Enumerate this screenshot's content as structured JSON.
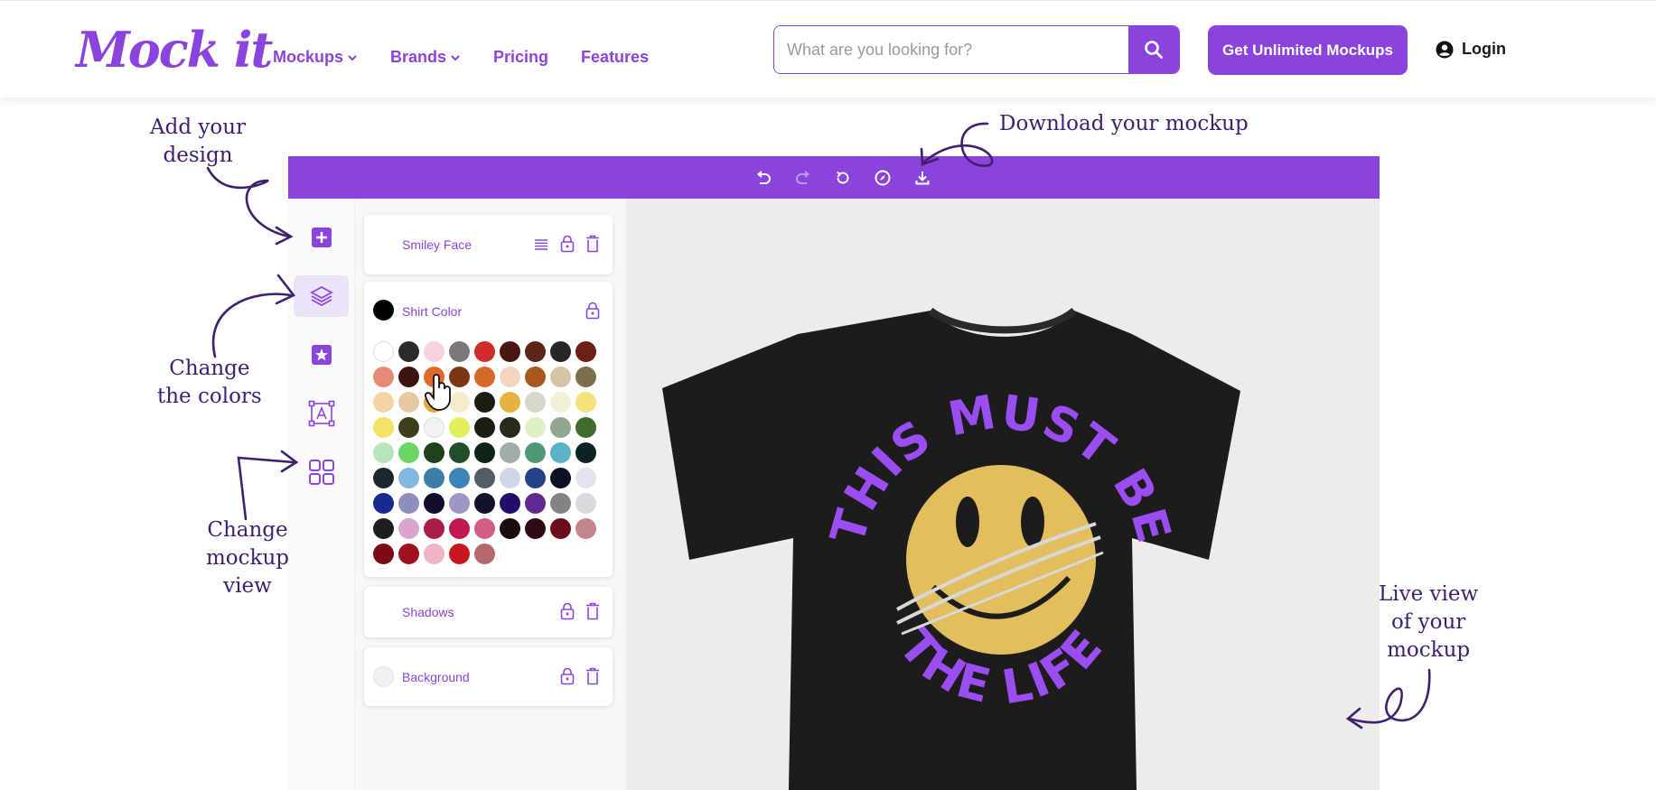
{
  "header": {
    "logo": "Mock it",
    "nav": [
      {
        "label": "Mockups",
        "dropdown": true
      },
      {
        "label": "Brands",
        "dropdown": true
      },
      {
        "label": "Pricing",
        "dropdown": false
      },
      {
        "label": "Features",
        "dropdown": false
      }
    ],
    "search_placeholder": "What are you looking for?",
    "cta_label": "Get Unlimited Mockups",
    "login_label": "Login"
  },
  "annotations": {
    "add_design": "Add your\ndesign",
    "download": "Download your mockup",
    "change_colors": "Change\nthe colors",
    "change_view": "Change\nmockup\nview",
    "live_view": "Live view\nof your\nmockup"
  },
  "toolbar": {
    "icons": [
      "undo-icon",
      "redo-icon",
      "reset-icon",
      "compass-icon",
      "download-icon"
    ]
  },
  "sidebar": {
    "tools": [
      "add-icon",
      "layers-icon",
      "star-icon",
      "text-icon",
      "grid-icon"
    ],
    "active": "layers-icon"
  },
  "layers": {
    "design_name": "Smiley Face",
    "shirt_color_label": "Shirt Color",
    "shirt_color": "#000000",
    "shadows_label": "Shadows",
    "background_label": "Background"
  },
  "palette": [
    [
      "#ffffff",
      "#2b2b2b",
      "#f6d3dc",
      "#7c7878",
      "#d32b2b",
      "#4a1410",
      "#5d2418",
      "#262626",
      "#6b1f16"
    ],
    [
      "#e58b73",
      "#3e1410",
      "#e06a2a",
      "#7b3512",
      "#d56a28",
      "#f3d5c0",
      "#a8581d",
      "#d4c3a4",
      "#7d6e4e"
    ],
    [
      "#f2d4a5",
      "#e6c9a2",
      "#e5aa3c",
      "#f3edcd",
      "#1d1c14",
      "#e7b13d",
      "#d5d6cd",
      "#f2f0d8",
      "#f4e27c"
    ],
    [
      "#f4e266",
      "#3d3f1a",
      "#f1f3ee",
      "#dff05c",
      "#1b1e14",
      "#272b1c",
      "#dfefc6",
      "#8fa68f",
      "#3f6b2c"
    ],
    [
      "#b8e3bb",
      "#69d564",
      "#1e4219",
      "#234c2a",
      "#0f2419",
      "#a2ada9",
      "#4f9775",
      "#59b2c7",
      "#0d2222"
    ],
    [
      "#1c2631",
      "#82b8df",
      "#3c7ea5",
      "#3d82b8",
      "#545c68",
      "#cfd7e6",
      "#27408a",
      "#0c1025",
      "#e2e4ec"
    ],
    [
      "#162a8f",
      "#8e8ebd",
      "#130d2e",
      "#9c97c5",
      "#12122a",
      "#240d6a",
      "#5e2a8f",
      "#838384",
      "#d9d9dd"
    ],
    [
      "#1e1f1d",
      "#d9a5cf",
      "#aa1d48",
      "#c21852",
      "#d35e83",
      "#1b0b0c",
      "#2d0b10",
      "#6b0c1c",
      "#c1868d"
    ],
    [
      "#7c0b16",
      "#9e1220",
      "#f0b4c2",
      "#c9171e",
      "#b4686b"
    ]
  ],
  "design": {
    "top_text": "THIS MUST BE",
    "bottom_text": "THE LIFE",
    "colors": {
      "shirt": "#1c1c1c",
      "text": "#9a4df0",
      "face": "#e2be5f",
      "brand": "#8a44dd"
    }
  }
}
